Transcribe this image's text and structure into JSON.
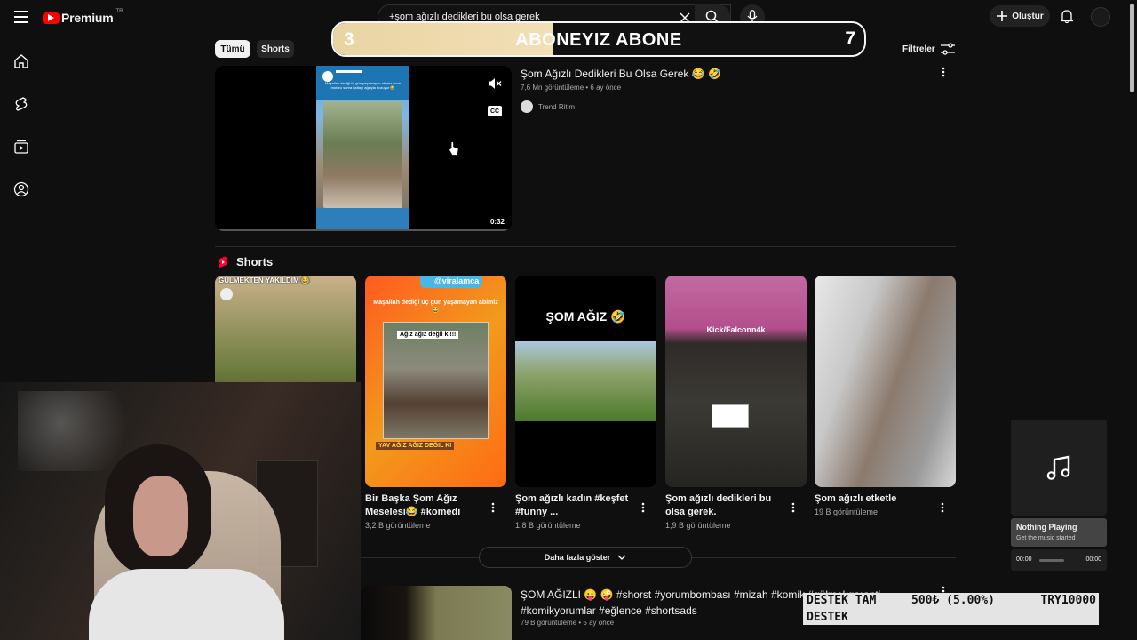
{
  "header": {
    "logo_text": "Premium",
    "logo_badge": "TR",
    "search_query": "+şom ağızlı dedikleri bu olsa gerek",
    "create_label": "Oluştur"
  },
  "filters": {
    "chips": [
      "Tümü",
      "Shorts"
    ],
    "active_chip": "Tümü",
    "filters_label": "Filtreler"
  },
  "overlay": {
    "left_count": "3",
    "title": "ABONEYIZ ABONE",
    "right_count": "7"
  },
  "video1": {
    "title": "Şom Ağızlı Dedikleri Bu Olsa Gerek 😂 🤣",
    "views": "7,6 Mn görüntüleme",
    "age": "6 ay önce",
    "channel": "Trend Ritim",
    "duration": "0:32",
    "preview_text": "Maşallah dediği üç gün yaşamayan abimiz önce motoru sonra baltayı ağzıyla bozuyor 😂"
  },
  "shorts": {
    "heading": "Shorts",
    "items": [
      {
        "title": "",
        "views": "",
        "overlay_text": "GÜLMEKTEN YAKILDIM 😂"
      },
      {
        "title": "Bir Başka Şom Ağız Meselesi😂 #komedi",
        "views": "3,2 B görüntüleme",
        "overlay_text": "@viralamca",
        "subtext": "Maşallah dediği üç gün yaşamayan abimiz 😂",
        "caption": "Ağız ağız değil ki!!!",
        "bottom_caption": "YAV AĞIZ AĞIZ DEĞIL KI"
      },
      {
        "title": "Şom ağızlı kadın #keşfet #funny ...",
        "views": "1,8 B görüntüleme",
        "overlay_text": "ŞOM AĞIZ 🤣"
      },
      {
        "title": "Şom ağızlı dedikleri bu olsa gerek.",
        "views": "1,9 B görüntüleme",
        "overlay_text": "Kick/Falconn4k"
      },
      {
        "title": "Şom ağızlı etketle",
        "views": "19 B görüntüleme",
        "overlay_text": ""
      }
    ]
  },
  "show_more_label": "Daha fazla göster",
  "video2": {
    "title": "ŞOM AĞIZLI 😛 🤪 #shorst #yorumbombası #mizah #komik #gülmekgaranti #komikyorumlar #eğlence #shortsads",
    "views": "79 B görüntüleme",
    "age": "5 ay önce"
  },
  "music_widget": {
    "status": "Nothing Playing",
    "subtitle": "Get the music started",
    "time_start": "00:00",
    "time_end": "00:00"
  },
  "donation": {
    "line1": "DESTEK TAM",
    "line2": "DESTEK",
    "amount": "500₺ (5.00%)",
    "goal": "TRY10000"
  }
}
